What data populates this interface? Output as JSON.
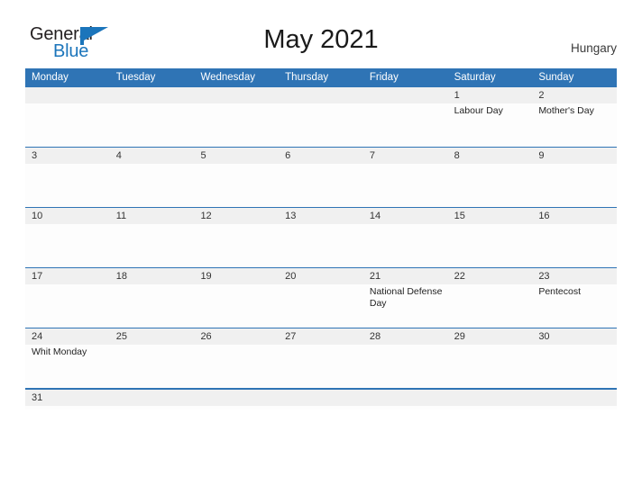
{
  "brand": {
    "name_part1": "General",
    "name_part2": "Blue",
    "flag_icon": "flag-triangle-icon",
    "colors": {
      "general_text": "#231f20",
      "blue_text": "#1b75bb",
      "flag": "#1b75bb"
    }
  },
  "header": {
    "title": "May 2021",
    "country": "Hungary"
  },
  "theme": {
    "header_blue": "#2f74b5",
    "row_line_blue": "#2f74b5",
    "number_strip_gray": "#f0f0f0",
    "page_background": "#ffffff",
    "cell_background": "#fdfdfd"
  },
  "calendar": {
    "weekdays": [
      "Monday",
      "Tuesday",
      "Wednesday",
      "Thursday",
      "Friday",
      "Saturday",
      "Sunday"
    ],
    "weeks": [
      {
        "days": [
          {
            "number": "",
            "event": ""
          },
          {
            "number": "",
            "event": ""
          },
          {
            "number": "",
            "event": ""
          },
          {
            "number": "",
            "event": ""
          },
          {
            "number": "",
            "event": ""
          },
          {
            "number": "1",
            "event": "Labour Day"
          },
          {
            "number": "2",
            "event": "Mother's Day"
          }
        ]
      },
      {
        "days": [
          {
            "number": "3",
            "event": ""
          },
          {
            "number": "4",
            "event": ""
          },
          {
            "number": "5",
            "event": ""
          },
          {
            "number": "6",
            "event": ""
          },
          {
            "number": "7",
            "event": ""
          },
          {
            "number": "8",
            "event": ""
          },
          {
            "number": "9",
            "event": ""
          }
        ]
      },
      {
        "days": [
          {
            "number": "10",
            "event": ""
          },
          {
            "number": "11",
            "event": ""
          },
          {
            "number": "12",
            "event": ""
          },
          {
            "number": "13",
            "event": ""
          },
          {
            "number": "14",
            "event": ""
          },
          {
            "number": "15",
            "event": ""
          },
          {
            "number": "16",
            "event": ""
          }
        ]
      },
      {
        "days": [
          {
            "number": "17",
            "event": ""
          },
          {
            "number": "18",
            "event": ""
          },
          {
            "number": "19",
            "event": ""
          },
          {
            "number": "20",
            "event": ""
          },
          {
            "number": "21",
            "event": "National Defense Day"
          },
          {
            "number": "22",
            "event": ""
          },
          {
            "number": "23",
            "event": "Pentecost"
          }
        ]
      },
      {
        "days": [
          {
            "number": "24",
            "event": "Whit Monday"
          },
          {
            "number": "25",
            "event": ""
          },
          {
            "number": "26",
            "event": ""
          },
          {
            "number": "27",
            "event": ""
          },
          {
            "number": "28",
            "event": ""
          },
          {
            "number": "29",
            "event": ""
          },
          {
            "number": "30",
            "event": ""
          }
        ]
      },
      {
        "days": [
          {
            "number": "31",
            "event": ""
          },
          {
            "number": "",
            "event": ""
          },
          {
            "number": "",
            "event": ""
          },
          {
            "number": "",
            "event": ""
          },
          {
            "number": "",
            "event": ""
          },
          {
            "number": "",
            "event": ""
          },
          {
            "number": "",
            "event": ""
          }
        ]
      }
    ]
  }
}
